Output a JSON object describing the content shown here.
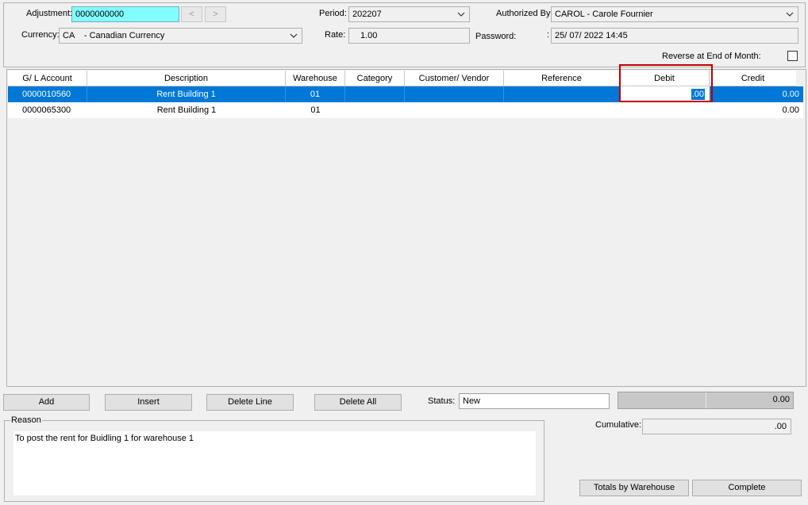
{
  "header": {
    "adjustment_label": "Adjustment:",
    "adjustment_value": "0000000000",
    "prev_label": "<",
    "next_label": ">",
    "currency_label": "Currency:",
    "currency_value": "CA    - Canadian Currency",
    "period_label": "Period:",
    "period_value": "202207",
    "rate_label": "Rate:",
    "rate_value": "1.00",
    "authorized_label": "Authorized By:",
    "authorized_value": "CAROL - Carole Fournier",
    "password_label": "Password:",
    "password_colon": ":",
    "password_value": "25/ 07/ 2022 14:45",
    "reverse_label": "Reverse at End of Month:",
    "reverse_checked": false
  },
  "grid": {
    "columns": [
      "G/ L Account",
      "Description",
      "Warehouse",
      "Category",
      "Customer/ Vendor",
      "Reference",
      "Debit",
      "Credit"
    ],
    "rows": [
      {
        "account": "0000010560",
        "description": "Rent Building 1",
        "warehouse": "01",
        "category": "",
        "customer": "",
        "reference": "",
        "debit": ".00",
        "credit": "0.00",
        "selected": true
      },
      {
        "account": "0000065300",
        "description": "Rent Building 1",
        "warehouse": "01",
        "category": "",
        "customer": "",
        "reference": "",
        "debit": "",
        "credit": "0.00",
        "selected": false
      }
    ]
  },
  "actions": {
    "add": "Add",
    "insert": "Insert",
    "delete_line": "Delete Line",
    "delete_all": "Delete All",
    "totals_by_warehouse": "Totals by Warehouse",
    "complete": "Complete"
  },
  "status": {
    "label": "Status:",
    "value": "New",
    "total_value": "0.00",
    "cumulative_label": "Cumulative:",
    "cumulative_value": ".00"
  },
  "reason": {
    "label": "Reason",
    "text": "To post the rent for Buidling 1 for warehouse 1"
  },
  "colors": {
    "selection": "#0078d7",
    "adjustment_field": "#80ffff",
    "highlight_border": "#c00000"
  }
}
